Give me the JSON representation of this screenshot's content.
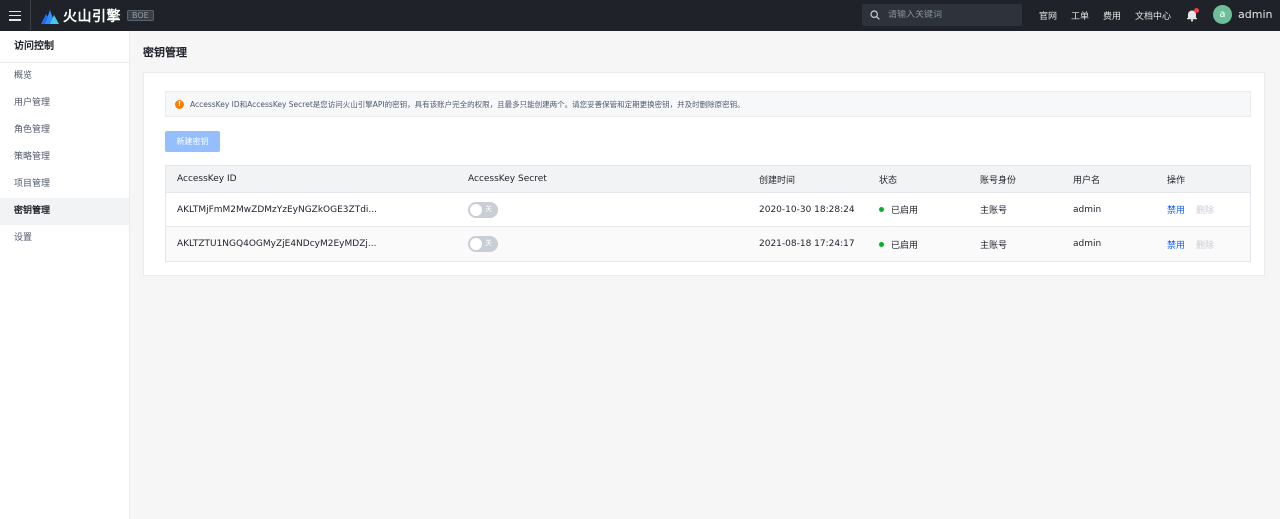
{
  "topbar": {
    "brand_name": "火山引擎",
    "brand_tag": "BOE",
    "search_placeholder": "请输入关键词",
    "links": [
      "官网",
      "工单",
      "费用",
      "文档中心"
    ],
    "avatar_letter": "a",
    "username": "admin"
  },
  "sidebar": {
    "title": "访问控制",
    "items": [
      {
        "label": "概览"
      },
      {
        "label": "用户管理"
      },
      {
        "label": "角色管理"
      },
      {
        "label": "策略管理"
      },
      {
        "label": "项目管理"
      },
      {
        "label": "密钥管理"
      },
      {
        "label": "设置"
      }
    ],
    "active_index": 5
  },
  "main": {
    "title": "密钥管理",
    "alert": "AccessKey ID和AccessKey Secret是您访问火山引擎API的密钥，具有该账户完全的权限，且最多只能创建两个。请您妥善保管和定期更换密钥，并及时删除原密钥。",
    "new_button": "新建密钥",
    "table": {
      "headers": [
        "AccessKey ID",
        "AccessKey Secret",
        "创建时间",
        "状态",
        "账号身份",
        "用户名",
        "操作"
      ],
      "rows": [
        {
          "id": "AKLTMjFmM2MwZDMzYzEyNGZkOGE3ZTdi...",
          "secret_switch": "关",
          "created": "2020-10-30 18:28:24",
          "status": "已启用",
          "identity": "主账号",
          "user": "admin",
          "action_disable": "禁用",
          "action_delete": "删除"
        },
        {
          "id": "AKLTZTU1NGQ4OGMyZjE4NDcyM2EyMDZj...",
          "secret_switch": "关",
          "created": "2021-08-18 17:24:17",
          "status": "已启用",
          "identity": "主账号",
          "user": "admin",
          "action_disable": "禁用",
          "action_delete": "删除"
        }
      ]
    }
  },
  "colors": {
    "topbar_bg": "#1f2329",
    "primary": "#165dff",
    "button_disabled": "#94bfff",
    "status_enabled": "#00b42a",
    "warning": "#ff7d00"
  }
}
